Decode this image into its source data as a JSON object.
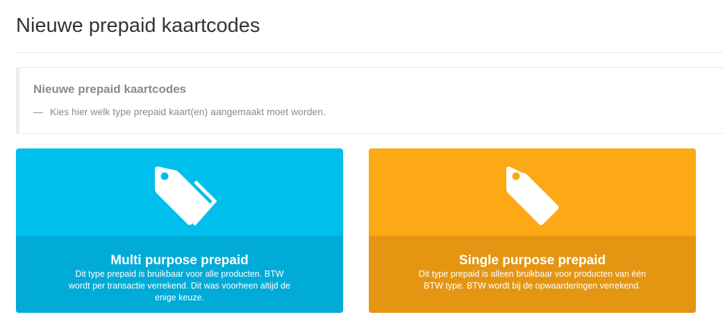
{
  "page": {
    "title": "Nieuwe prepaid kaartcodes"
  },
  "callout": {
    "title": "Nieuwe prepaid kaartcodes",
    "dash": "—",
    "text": "Kies hier welk type prepaid kaart(en) aangemaakt moet worden."
  },
  "cards": [
    {
      "title": "Multi purpose prepaid",
      "description": "Dit type prepaid is bruikbaar voor alle producten. BTW wordt per transactie verrekend. Dit was voorheen altijd de enige keuze.",
      "icon": "tags-icon",
      "color": "#00bfed",
      "color_dark": "#00abd7"
    },
    {
      "title": "Single purpose prepaid",
      "description": "Dit type prepaid is alleen bruikbaar voor producten van één BTW type. BTW wordt bij de opwaarderingen verrekend.",
      "icon": "tag-icon",
      "color": "#fca915",
      "color_dark": "#e49612"
    }
  ]
}
